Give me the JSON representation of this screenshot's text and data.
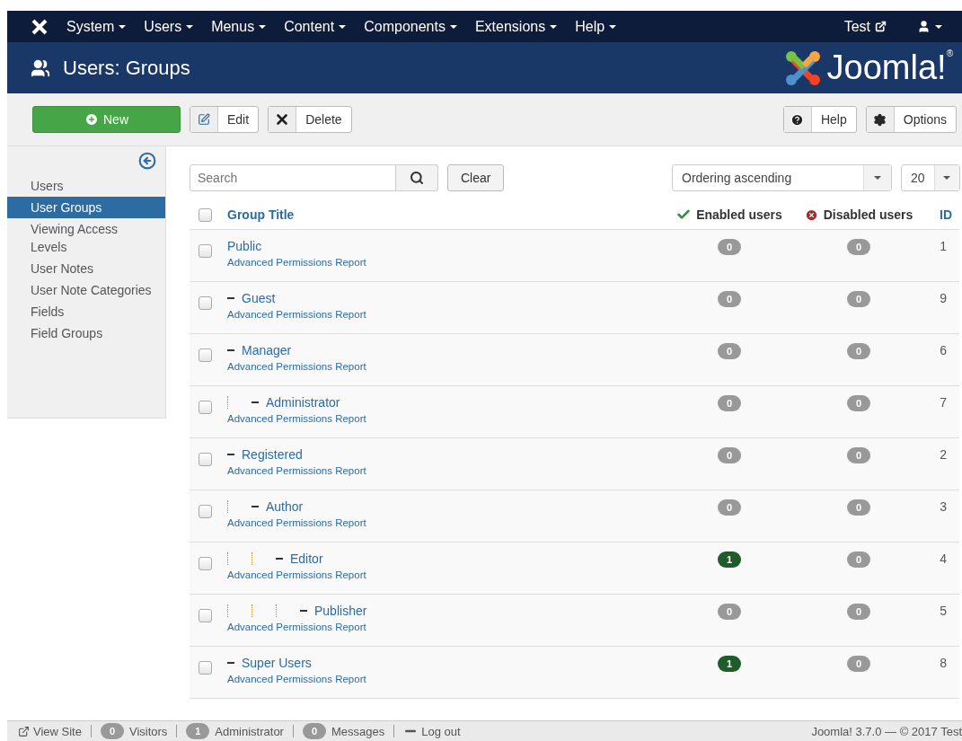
{
  "navbar": {
    "menus": [
      {
        "label": "System"
      },
      {
        "label": "Users"
      },
      {
        "label": "Menus"
      },
      {
        "label": "Content"
      },
      {
        "label": "Components"
      },
      {
        "label": "Extensions"
      },
      {
        "label": "Help"
      }
    ],
    "site_link": "Test"
  },
  "header": {
    "title": "Users: Groups",
    "logo": "Joomla!$^{®}$"
  },
  "toolbar": {
    "new": "New",
    "edit": "Edit",
    "delete": "Delete",
    "help": "Help",
    "options": "Options"
  },
  "sidebar": {
    "items": [
      {
        "label": "Users",
        "selected": false
      },
      {
        "label": "User Groups",
        "selected": true
      },
      {
        "label": "Viewing Access Levels",
        "selected": false
      },
      {
        "label": "User Notes",
        "selected": false
      },
      {
        "label": "User Note Categories",
        "selected": false
      },
      {
        "label": "Fields",
        "selected": false
      },
      {
        "label": "Field Groups",
        "selected": false
      }
    ]
  },
  "filters": {
    "search": {
      "placeholder": "Search"
    },
    "clear": "Clear",
    "ordering": "Ordering ascending",
    "limit": "20"
  },
  "table": {
    "header_checked": false,
    "columns": [
      "Group Title",
      "Enabled users",
      "Disabled users",
      "ID"
    ],
    "rows": [
      {
        "title": "Public",
        "link": "Advanced Permissions Report",
        "enabled": {
          "count": "0",
          "color": "#999999"
        },
        "disabled": {
          "count": "0",
          "color": "#999999"
        },
        "id": "1",
        "checked": false,
        "children": [
          {
            "title": "Guest",
            "link": "Advanced Permissions Report",
            "enabled": {
              "count": "0",
              "color": "#999999"
            },
            "disabled": {
              "count": "0",
              "color": "#999999"
            },
            "id": "9",
            "checked": false
          },
          {
            "title": "Manager",
            "link": "Advanced Permissions Report",
            "enabled": {
              "count": "0",
              "color": "#999999"
            },
            "disabled": {
              "count": "0",
              "color": "#999999"
            },
            "id": "6",
            "checked": false,
            "children": [
              {
                "title": "Administrator",
                "link": "Advanced Permissions Report",
                "enabled": {
                  "count": "0",
                  "color": "#999999"
                },
                "disabled": {
                  "count": "0",
                  "color": "#999999"
                },
                "id": "7",
                "checked": false
              }
            ]
          },
          {
            "title": "Registered",
            "link": "Advanced Permissions Report",
            "enabled": {
              "count": "0",
              "color": "#999999"
            },
            "disabled": {
              "count": "0",
              "color": "#999999"
            },
            "id": "2",
            "checked": false,
            "children": [
              {
                "title": "Author",
                "link": "Advanced Permissions Report",
                "enabled": {
                  "count": "0",
                  "color": "#999999"
                },
                "disabled": {
                  "count": "0",
                  "color": "#999999"
                },
                "id": "3",
                "checked": false,
                "children": [
                  {
                    "title": "Editor",
                    "link": "Advanced Permissions Report",
                    "enabled": {
                      "count": "1",
                      "color": "#1e5c2a"
                    },
                    "disabled": {
                      "count": "0",
                      "color": "#999999"
                    },
                    "id": "4",
                    "checked": false,
                    "children": [
                      {
                        "title": "Publisher",
                        "link": "Advanced Permissions Report",
                        "enabled": {
                          "count": "0",
                          "color": "#999999"
                        },
                        "disabled": {
                          "count": "0",
                          "color": "#999999"
                        },
                        "id": "5",
                        "checked": false
                      }
                    ]
                  }
                ]
              }
            ]
          },
          {
            "title": "Super Users",
            "link": "Advanced Permissions Report",
            "enabled": {
              "count": "1",
              "color": "#1e5c2a"
            },
            "disabled": {
              "count": "0",
              "color": "#999999"
            },
            "id": "8",
            "checked": false
          }
        ]
      }
    ]
  },
  "status_bar": {
    "view_site": "View Site",
    "visitors": {
      "count": "0",
      "label": "Visitors"
    },
    "admins": {
      "count": "1",
      "label": "Administrator"
    },
    "messages": {
      "count": "0",
      "label": "Messages"
    },
    "logout": "Log out",
    "version": "Joomla! 3.7.0 — © 2017 Test"
  }
}
